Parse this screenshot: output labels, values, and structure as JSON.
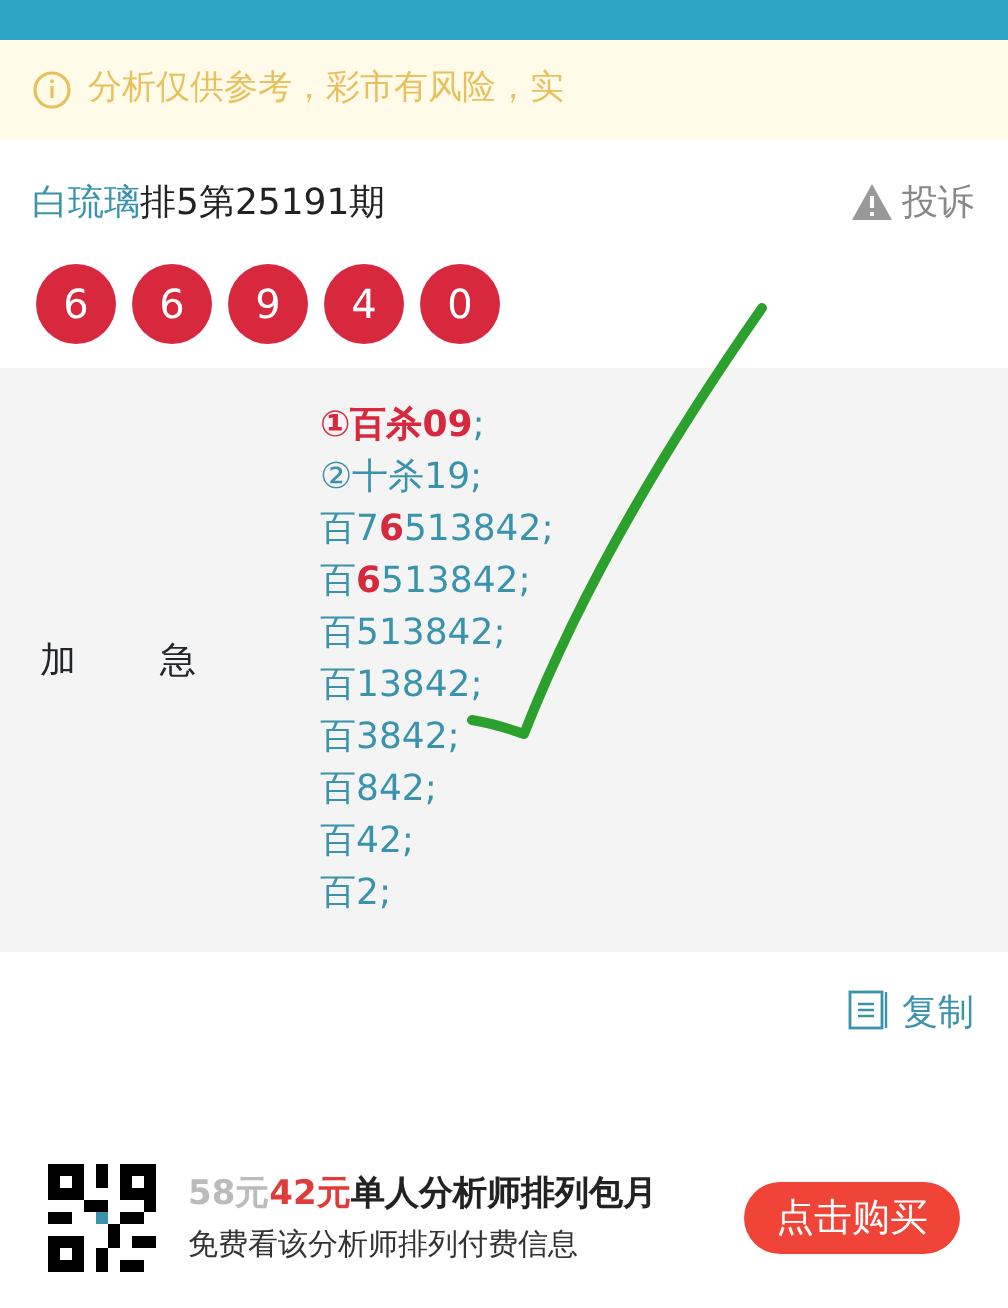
{
  "notice": {
    "text": "分析仅供参考，彩市有风险，实"
  },
  "heading": {
    "author": "白琉璃",
    "issue": "排5第25191期",
    "report": "投诉"
  },
  "balls": [
    "6",
    "6",
    "9",
    "4",
    "0"
  ],
  "analysis": {
    "label_1": "加",
    "label_2": "急",
    "lines": [
      "**①百杀09**;",
      "②十杀19;",
      "百7**6**513842;",
      "百**6**513842;",
      "百513842;",
      "百13842;",
      "百3842;",
      "百842;",
      "百42;",
      "百2;"
    ]
  },
  "copy": {
    "label": "复制"
  },
  "offer": {
    "old_price": "58元",
    "new_price": "42元",
    "title": "单人分析师排列包月",
    "subtitle": "免费看该分析师排列付费信息",
    "button": "点击购买"
  }
}
